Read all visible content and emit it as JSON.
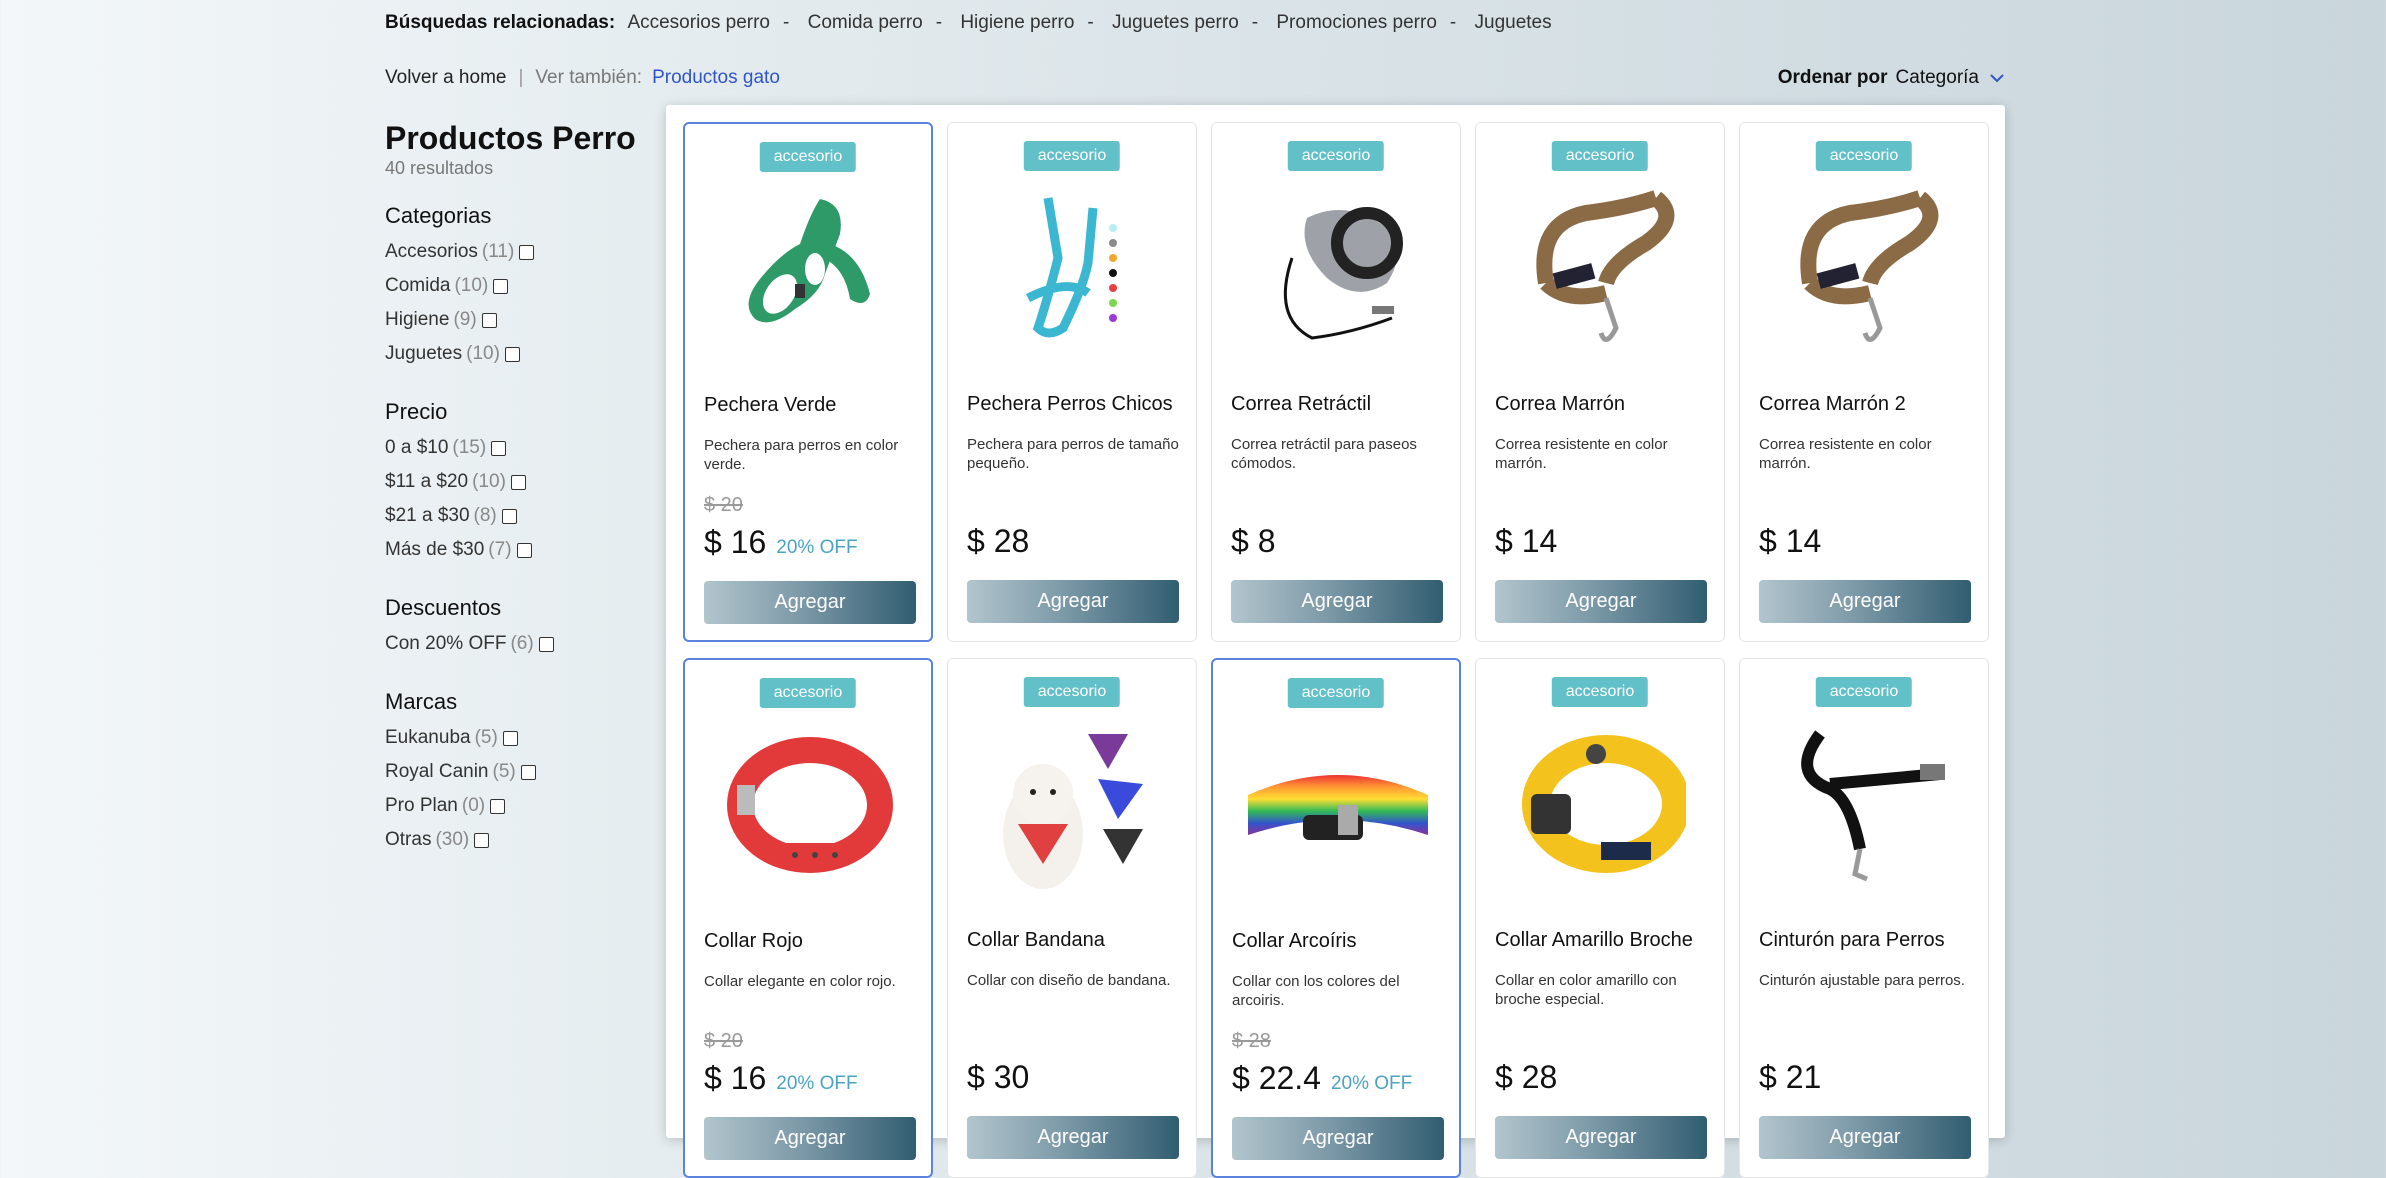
{
  "related": {
    "title": "Búsquedas relacionadas:",
    "items": [
      "Accesorios perro",
      "Comida perro",
      "Higiene perro",
      "Juguetes perro",
      "Promociones perro",
      "Juguetes"
    ]
  },
  "nav": {
    "home": "Volver a home",
    "see_also": "Ver también:",
    "link": "Productos gato"
  },
  "order": {
    "label": "Ordenar por",
    "value": "Categoría"
  },
  "sidebar": {
    "title": "Productos Perro",
    "results": "40 resultados",
    "sections": [
      {
        "title": "Categorias",
        "options": [
          {
            "label": "Accesorios",
            "count": "(11)"
          },
          {
            "label": "Comida",
            "count": "(10)"
          },
          {
            "label": "Higiene",
            "count": "(9)"
          },
          {
            "label": "Juguetes",
            "count": "(10)"
          }
        ]
      },
      {
        "title": "Precio",
        "options": [
          {
            "label": "0 a $10",
            "count": "(15)"
          },
          {
            "label": "$11 a $20",
            "count": "(10)"
          },
          {
            "label": "$21 a $30",
            "count": "(8)"
          },
          {
            "label": "Más de $30",
            "count": "(7)"
          }
        ]
      },
      {
        "title": "Descuentos",
        "options": [
          {
            "label": "Con 20% OFF",
            "count": "(6)"
          }
        ]
      },
      {
        "title": "Marcas",
        "options": [
          {
            "label": "Eukanuba",
            "count": "(5)"
          },
          {
            "label": "Royal Canin",
            "count": "(5)"
          },
          {
            "label": "Pro Plan",
            "count": "(0)"
          },
          {
            "label": "Otras",
            "count": "(30)"
          }
        ]
      }
    ]
  },
  "products": [
    {
      "badge": "accesorio",
      "name": "Pechera Verde",
      "desc": "Pechera para perros en color verde.",
      "old": "$ 20",
      "price": "$ 16",
      "off": "20% OFF",
      "button": "Agregar",
      "img": "harness-green"
    },
    {
      "badge": "accesorio",
      "name": "Pechera Perros Chicos",
      "desc": "Pechera para perros de tamaño pequeño.",
      "old": "",
      "price": "$ 28",
      "off": "",
      "button": "Agregar",
      "img": "harness-blue"
    },
    {
      "badge": "accesorio",
      "name": "Correa Retráctil",
      "desc": "Correa retráctil para paseos cómodos.",
      "old": "",
      "price": "$ 8",
      "off": "",
      "button": "Agregar",
      "img": "retractable-leash"
    },
    {
      "badge": "accesorio",
      "name": "Correa Marrón",
      "desc": "Correa resistente en color marrón.",
      "old": "",
      "price": "$ 14",
      "off": "",
      "button": "Agregar",
      "img": "leash-brown"
    },
    {
      "badge": "accesorio",
      "name": "Correa Marrón 2",
      "desc": "Correa resistente en color marrón.",
      "old": "",
      "price": "$ 14",
      "off": "",
      "button": "Agregar",
      "img": "leash-brown"
    },
    {
      "badge": "accesorio",
      "name": "Collar Rojo",
      "desc": "Collar elegante en color rojo.",
      "old": "$ 20",
      "price": "$ 16",
      "off": "20% OFF",
      "button": "Agregar",
      "img": "collar-red"
    },
    {
      "badge": "accesorio",
      "name": "Collar Bandana",
      "desc": "Collar con diseño de bandana.",
      "old": "",
      "price": "$ 30",
      "off": "",
      "button": "Agregar",
      "img": "bandana-dog"
    },
    {
      "badge": "accesorio",
      "name": "Collar Arcoíris",
      "desc": "Collar con los colores del arcoiris.",
      "old": "$ 28",
      "price": "$ 22.4",
      "off": "20% OFF",
      "button": "Agregar",
      "img": "collar-rainbow"
    },
    {
      "badge": "accesorio",
      "name": "Collar Amarillo Broche",
      "desc": "Collar en color amarillo con broche especial.",
      "old": "",
      "price": "$ 28",
      "off": "",
      "button": "Agregar",
      "img": "collar-yellow"
    },
    {
      "badge": "accesorio",
      "name": "Cinturón para Perros",
      "desc": "Cinturón ajustable para perros.",
      "old": "",
      "price": "$ 21",
      "off": "",
      "button": "Agregar",
      "img": "seatbelt"
    }
  ]
}
